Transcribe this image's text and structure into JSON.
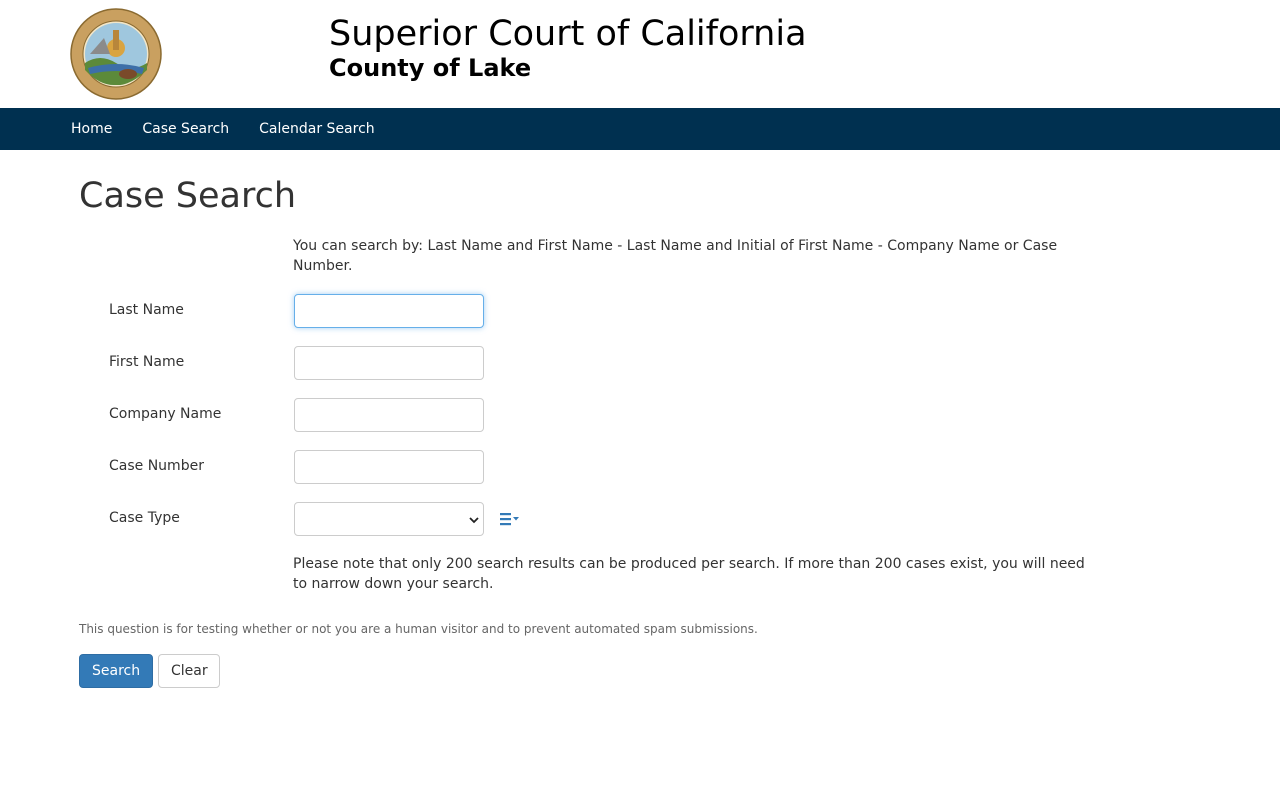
{
  "header": {
    "title": "Superior Court of California",
    "subtitle": "County of Lake",
    "seal_icon": "california-seal-icon"
  },
  "nav": {
    "items": [
      {
        "label": "Home"
      },
      {
        "label": "Case Search"
      },
      {
        "label": "Calendar Search"
      }
    ]
  },
  "main": {
    "page_title": "Case Search",
    "intro": "You can search by: Last Name and First Name - Last Name and Initial of First Name - Company Name or Case Number.",
    "fields": {
      "last_name": {
        "label": "Last Name",
        "value": ""
      },
      "first_name": {
        "label": "First Name",
        "value": ""
      },
      "company_name": {
        "label": "Company Name",
        "value": ""
      },
      "case_number": {
        "label": "Case Number",
        "value": ""
      },
      "case_type": {
        "label": "Case Type",
        "selected": ""
      }
    },
    "note": "Please note that only 200 search results can be produced per search. If more than 200 cases exist, you will need to narrow down your search.",
    "captcha_text": "This question is for testing whether or not you are a human visitor and to prevent automated spam submissions.",
    "buttons": {
      "search": "Search",
      "clear": "Clear"
    }
  },
  "colors": {
    "navbar": "#003050",
    "primary_button": "#337ab7",
    "list_icon": "#337ab7"
  }
}
